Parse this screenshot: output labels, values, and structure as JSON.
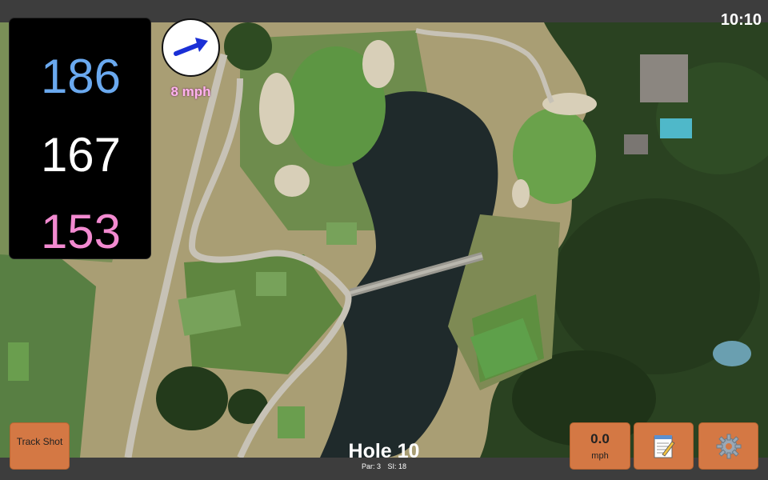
{
  "status": {
    "time": "10:10"
  },
  "distances": {
    "back": "186",
    "middle": "167",
    "front": "153"
  },
  "wind": {
    "speed": "8 mph",
    "direction": "north-east"
  },
  "hole": {
    "title": "Hole 10",
    "par": "Par: 3",
    "si": "SI: 18"
  },
  "buttons": {
    "track_shot": "Track Shot",
    "speed_value": "0.0",
    "speed_unit": "mph",
    "notes_icon": "notepad-icon",
    "settings_icon": "gear-icon"
  },
  "colors": {
    "back_distance": "#6aa9ef",
    "middle_distance": "#ffffff",
    "front_distance": "#f28ad0",
    "button": "#d47844",
    "wind_arrow": "#1a2fd6",
    "wind_text": "#ffb3ee"
  }
}
